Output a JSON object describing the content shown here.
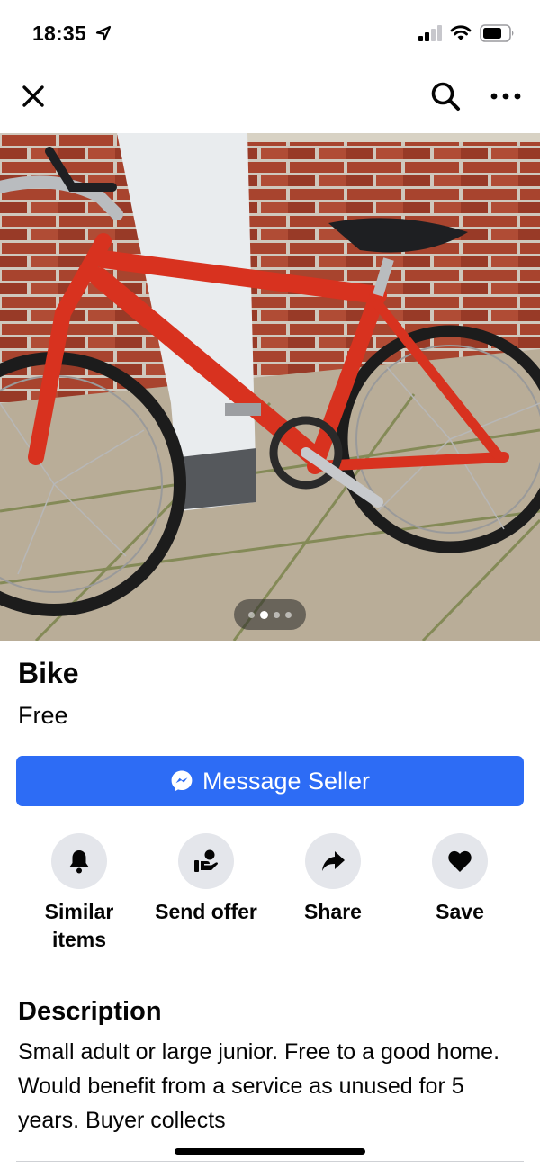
{
  "status_bar": {
    "time": "18:35"
  },
  "listing": {
    "title": "Bike",
    "price": "Free",
    "photo_index": 2,
    "photo_count": 4
  },
  "message_button": {
    "label": "Message Seller"
  },
  "actions": [
    {
      "label": "Similar\nitems",
      "icon": "bell-icon"
    },
    {
      "label": "Send offer",
      "icon": "send-offer-icon"
    },
    {
      "label": "Share",
      "icon": "share-arrow-icon"
    },
    {
      "label": "Save",
      "icon": "heart-icon"
    }
  ],
  "description": {
    "heading": "Description",
    "body": "Small adult or large junior. Free to a good home. Would benefit from a service as unused for 5 years. Buyer collects"
  },
  "colors": {
    "accent": "#2d6cf5",
    "action_bg": "#e4e6eb"
  }
}
